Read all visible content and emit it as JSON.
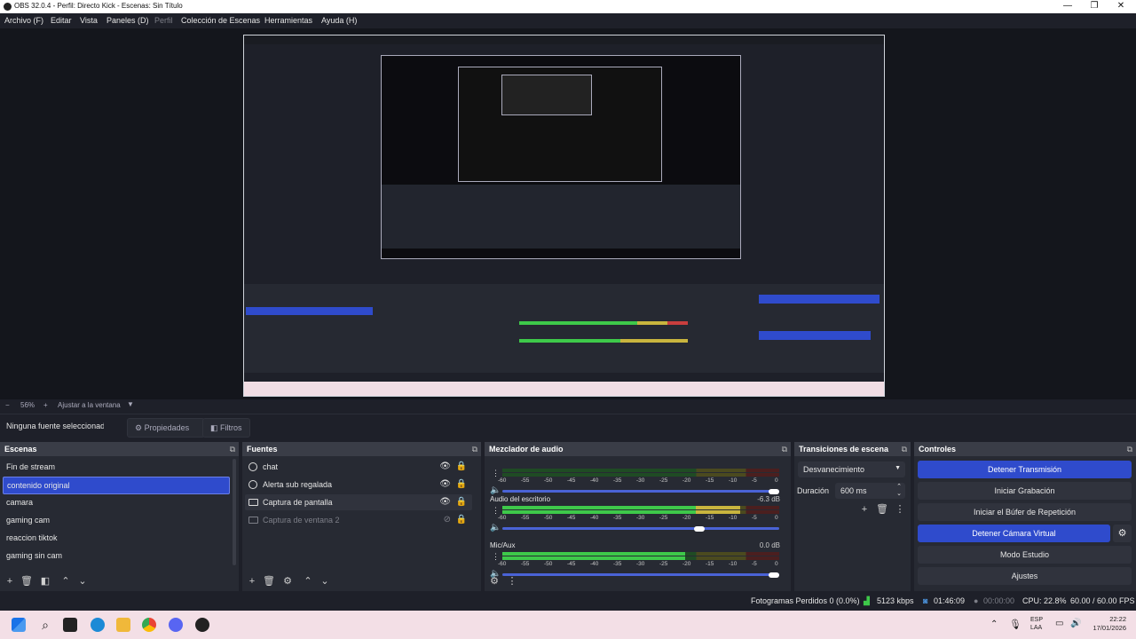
{
  "window": {
    "title": "OBS 32.0.4 - Perfil: Directo Kick - Escenas: Sin Título"
  },
  "window_controls": {
    "minimize": "—",
    "maximize": "❐",
    "close": "✕"
  },
  "menu": [
    {
      "label": "Archivo (F)",
      "enabled": true
    },
    {
      "label": "Editar",
      "enabled": true
    },
    {
      "label": "Vista",
      "enabled": true
    },
    {
      "label": "Paneles (D)",
      "enabled": true
    },
    {
      "label": "Perfil",
      "enabled": false
    },
    {
      "label": "Colección de Escenas",
      "enabled": true
    },
    {
      "label": "Herramientas",
      "enabled": true
    },
    {
      "label": "Ayuda (H)",
      "enabled": true
    }
  ],
  "zoom": {
    "minus": "−",
    "level": "56%",
    "plus": "+",
    "fit_label": "Ajustar a la ventana"
  },
  "properties_bar": {
    "no_source": "Ninguna fuente seleccionada",
    "properties": "Propiedades",
    "filters": "Filtros"
  },
  "scenes": {
    "title": "Escenas",
    "items": [
      "Fin de stream",
      "contenido original",
      "camara",
      "gaming cam",
      "reaccion tiktok",
      "gaming sin cam"
    ],
    "selected_index": 1
  },
  "sources": {
    "title": "Fuentes",
    "items": [
      {
        "label": "chat",
        "icon": "globe-icon",
        "visible": true
      },
      {
        "label": "Alerta sub regalada",
        "icon": "globe-icon",
        "visible": true
      },
      {
        "label": "Captura de pantalla",
        "icon": "monitor-icon",
        "visible": true
      },
      {
        "label": "Captura de ventana 2",
        "icon": "window-icon",
        "visible": false
      }
    ]
  },
  "mixer": {
    "title": "Mezclador de audio",
    "ticks": [
      "-60",
      "-55",
      "-50",
      "-45",
      "-40",
      "-35",
      "-30",
      "-25",
      "-20",
      "-15",
      "-10",
      "-5",
      "0"
    ],
    "channels": [
      {
        "name": "",
        "db": "",
        "level": 0.0,
        "volume": 1.0
      },
      {
        "name": "Audio del escritorio",
        "db": "-6.3 dB",
        "level": 0.86,
        "volume": 0.73
      },
      {
        "name": "Mic/Aux",
        "db": "0.0 dB",
        "level": 0.66,
        "volume": 1.0
      }
    ]
  },
  "transitions": {
    "title": "Transiciones de escena",
    "selected": "Desvanecimiento",
    "duration_label": "Duración",
    "duration_value": "600 ms"
  },
  "controls": {
    "title": "Controles",
    "buttons": [
      {
        "label": "Detener Transmisión",
        "active": true
      },
      {
        "label": "Iniciar Grabación",
        "active": false
      },
      {
        "label": "Iniciar el Búfer de Repetición",
        "active": false
      },
      {
        "label": "Detener Cámara Virtual",
        "active": true
      },
      {
        "label": "Modo Estudio",
        "active": false
      },
      {
        "label": "Ajustes",
        "active": false
      }
    ]
  },
  "status": {
    "dropped": "Fotogramas Perdidos 0 (0.0%)",
    "bitrate": "5123 kbps",
    "stream_time": "01:46:09",
    "rec_time": "00:00:00",
    "cpu": "CPU: 22.8%",
    "fps": "60.00 / 60.00 FPS"
  },
  "taskbar": {
    "lang": "ESP",
    "region": "LAA",
    "time": "22:22",
    "date": "17/01/2026"
  },
  "colors": {
    "accent": "#2f4bcc",
    "meter_green": "#3ec94a",
    "meter_yellow": "#c9b53e",
    "meter_red": "#c93e3e"
  }
}
